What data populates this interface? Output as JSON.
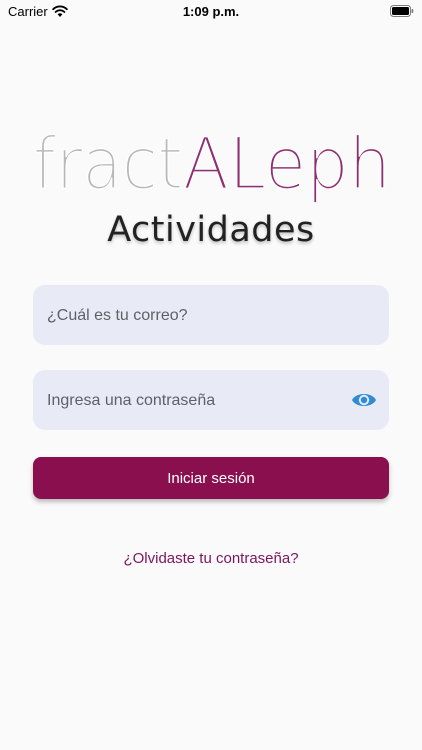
{
  "status_bar": {
    "carrier": "Carrier",
    "time": "1:09 p.m."
  },
  "logo": {
    "part1": "fract",
    "part2": "ALeph",
    "part1_color": "#b8b8b8",
    "part2_color": "#8e2f72"
  },
  "header": {
    "subtitle": "Actividades"
  },
  "form": {
    "email_placeholder": "¿Cuál es tu correo?",
    "email_value": "",
    "password_placeholder": "Ingresa una contraseña",
    "password_value": "",
    "eye_icon": "eye-icon",
    "submit_label": "Iniciar sesión",
    "forgot_label": "¿Olvidaste tu contraseña?"
  },
  "colors": {
    "primary": "#8a0f4f",
    "field_bg": "#e8eaf6",
    "eye_icon_color": "#2f8bd6",
    "link_color": "#7a1660"
  }
}
